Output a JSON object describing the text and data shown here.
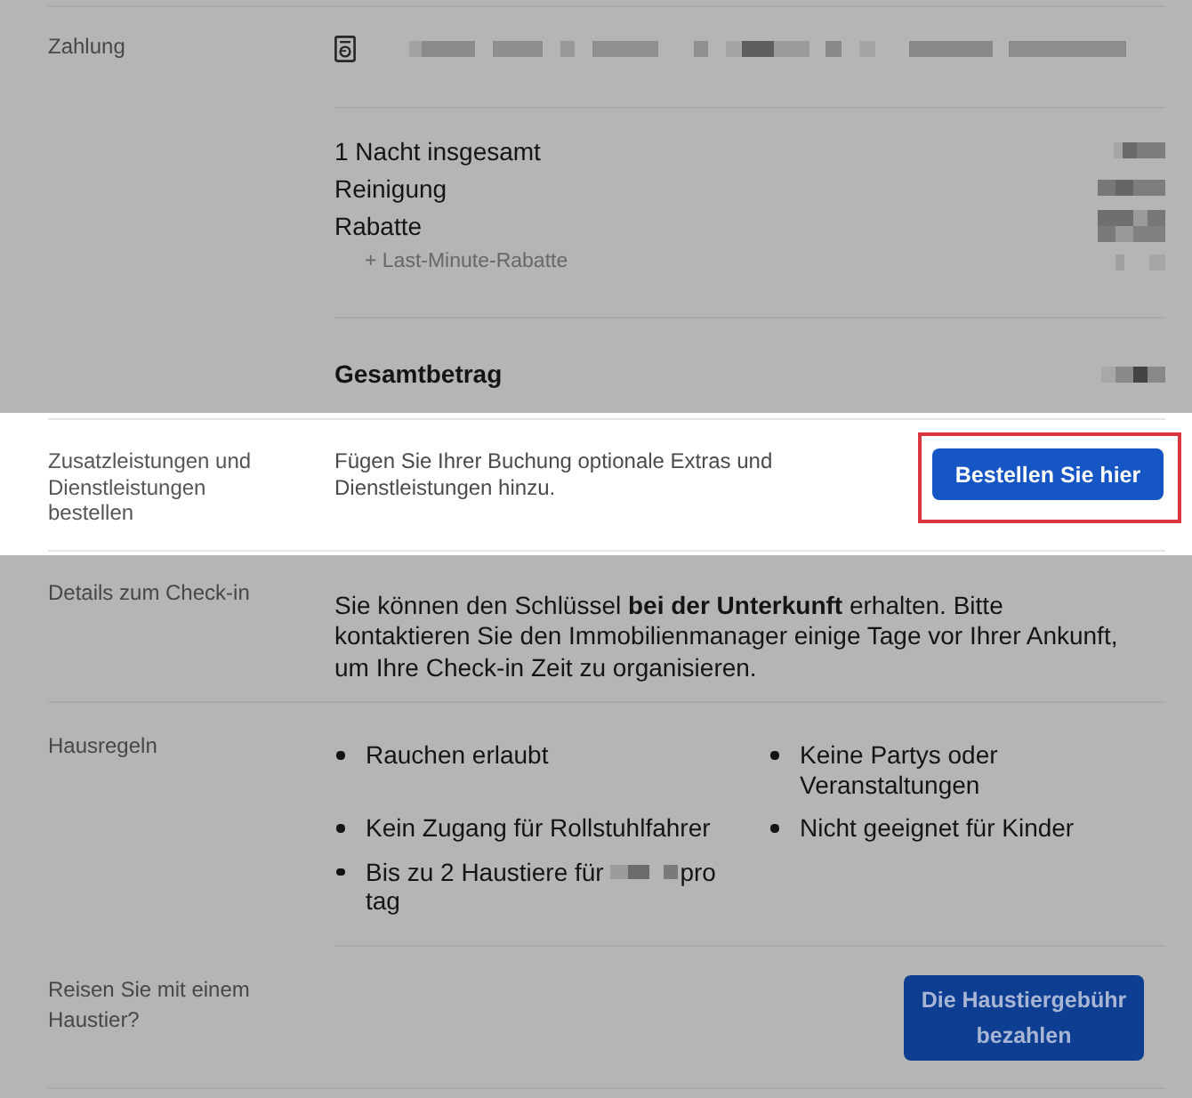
{
  "sections": [
    {
      "kind": "payment",
      "label": "Zahlung",
      "highlighted": false,
      "payment_method": {
        "redacted": true
      },
      "price_lines": [
        {
          "kind": "line",
          "text": "1 Nacht insgesamt",
          "redacted": true
        },
        {
          "kind": "line",
          "text": "Reinigung",
          "redacted": true
        },
        {
          "kind": "line",
          "text": "Rabatte",
          "redacted": true
        },
        {
          "kind": "sub",
          "text": "+ Last-Minute-Rabatte",
          "redacted": true
        }
      ],
      "total": {
        "text": "Gesamtbetrag",
        "redacted": true
      }
    },
    {
      "kind": "action",
      "label": "Zusatzleistungen und Dienstleistungen bestellen",
      "highlighted": true,
      "text": "Fügen Sie Ihrer Buchung optionale Extras und Dienstleistungen hinzu.",
      "button": {
        "label": "Bestellen Sie hier",
        "outlined": true
      }
    },
    {
      "kind": "text",
      "label": "Details zum Check-in",
      "highlighted": false,
      "text": "Sie können den Schlüssel **bei der Unterkunft** erhalten. Bitte kontaktieren Sie den Immobilienmanager einige Tage vor Ihrer Ankunft, um Ihre Check-in Zeit zu organisieren."
    },
    {
      "kind": "rules",
      "label": "Hausregeln",
      "highlighted": false,
      "rules": [
        {
          "text": "Rauchen erlaubt"
        },
        {
          "text": "Keine Partys oder Veranstaltungen"
        },
        {
          "text": "Kein Zugang für Rollstuhlfahrer"
        },
        {
          "text": "Nicht geeignet für Kinder"
        },
        {
          "text": "Bis zu 2 Haustiere für",
          "redacted": true,
          "suffix": "pro tag"
        }
      ],
      "pet": {
        "label": "Reisen Sie mit einem Haustier?",
        "button": {
          "label": "Die Haustiergebühr bezahlen",
          "outlined": false
        }
      }
    }
  ]
}
